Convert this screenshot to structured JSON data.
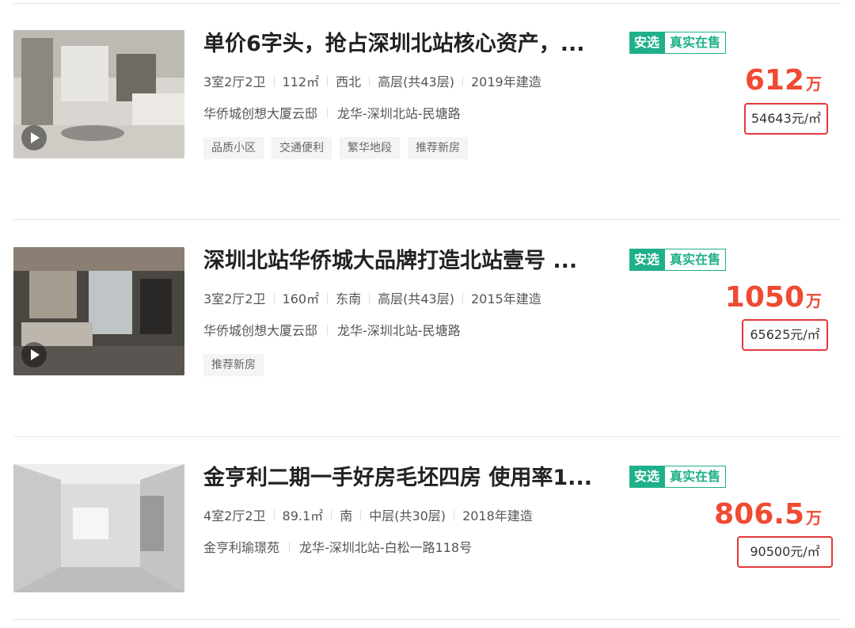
{
  "listings": [
    {
      "title": "单价6字头，抢占深圳北站核心资产，...",
      "badge_primary": "安选",
      "badge_secondary": "真实在售",
      "layout": "3室2厅2卫",
      "area": "112㎡",
      "orientation": "西北",
      "floor": "高层(共43层)",
      "year": "2019年建造",
      "community": "华侨城创想大厦云邸",
      "district": "龙华-深圳北站-民塘路",
      "tags": [
        "品质小区",
        "交通便利",
        "繁华地段",
        "推荐新房"
      ],
      "price": "612",
      "price_unit": "万",
      "unit_price": "54643元/㎡",
      "has_video": true
    },
    {
      "title": "深圳北站华侨城大品牌打造北站壹号 ...",
      "badge_primary": "安选",
      "badge_secondary": "真实在售",
      "layout": "3室2厅2卫",
      "area": "160㎡",
      "orientation": "东南",
      "floor": "高层(共43层)",
      "year": "2015年建造",
      "community": "华侨城创想大厦云邸",
      "district": "龙华-深圳北站-民塘路",
      "tags": [
        "推荐新房"
      ],
      "price": "1050",
      "price_unit": "万",
      "unit_price": "65625元/㎡",
      "has_video": true
    },
    {
      "title": "金亨利二期一手好房毛坯四房 使用率1...",
      "badge_primary": "安选",
      "badge_secondary": "真实在售",
      "layout": "4室2厅2卫",
      "area": "89.1㎡",
      "orientation": "南",
      "floor": "中层(共30层)",
      "year": "2018年建造",
      "community": "金亨利瑜璟苑",
      "district": "龙华-深圳北站-白松一路118号",
      "tags": [],
      "price": "806.5",
      "price_unit": "万",
      "unit_price": "90500元/㎡",
      "has_video": false
    }
  ],
  "colors": {
    "accent_green": "#1fb08a",
    "price_red": "#f04a32",
    "box_red": "#e4393c"
  }
}
